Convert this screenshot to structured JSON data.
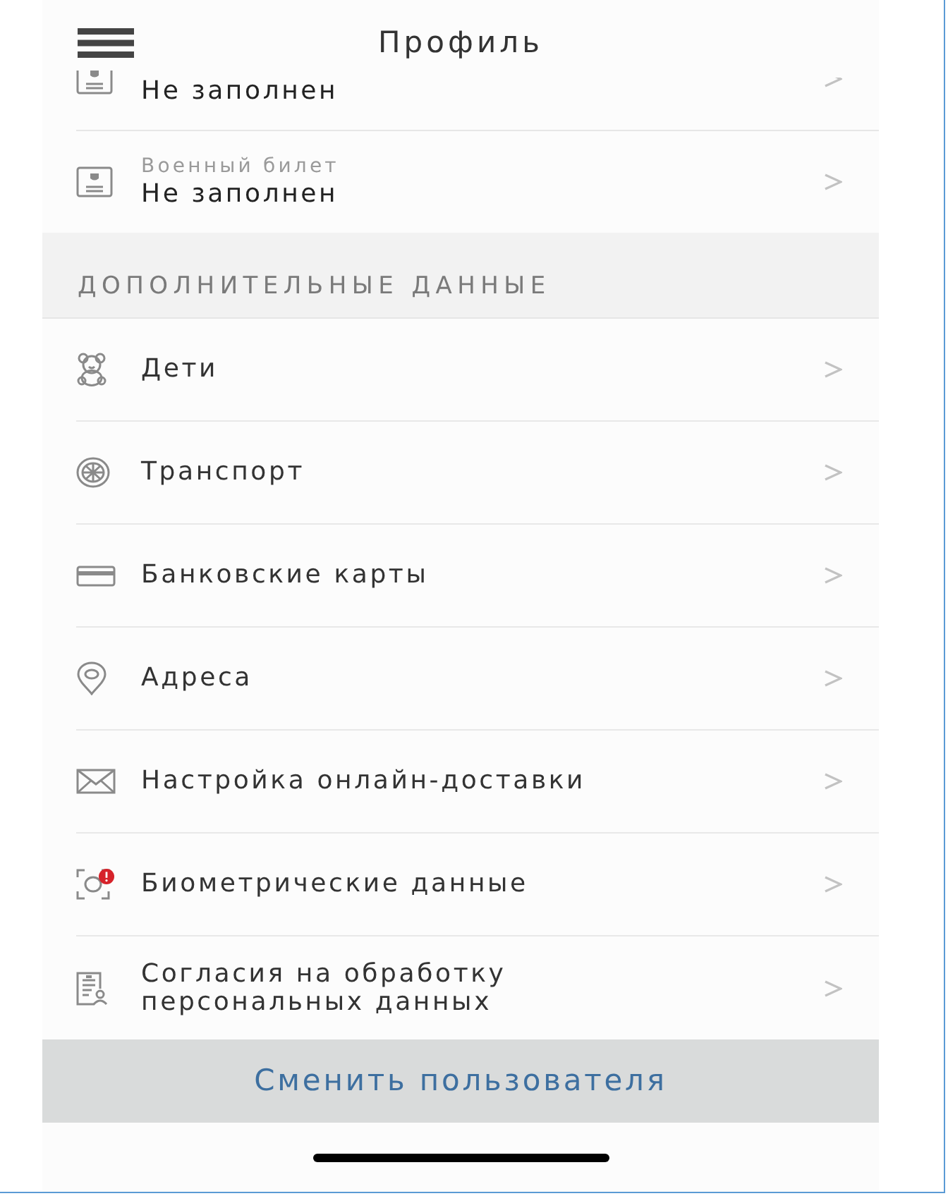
{
  "header": {
    "title": "Профиль"
  },
  "documents": [
    {
      "value": "Не заполнен"
    },
    {
      "label": "Военный билет",
      "value": "Не заполнен"
    }
  ],
  "section": {
    "title": "ДОПОЛНИТЕЛЬНЫЕ ДАННЫЕ"
  },
  "items": [
    {
      "label": "Дети",
      "alert": false
    },
    {
      "label": "Транспорт",
      "alert": false
    },
    {
      "label": "Банковские карты",
      "alert": false
    },
    {
      "label": "Адреса",
      "alert": false
    },
    {
      "label": "Настройка онлайн-доставки",
      "alert": false
    },
    {
      "label": "Биометрические данные",
      "alert": true
    },
    {
      "label": "Согласия на обработку персональных данных",
      "alert": false
    }
  ],
  "button": {
    "label": "Сменить пользователя"
  }
}
